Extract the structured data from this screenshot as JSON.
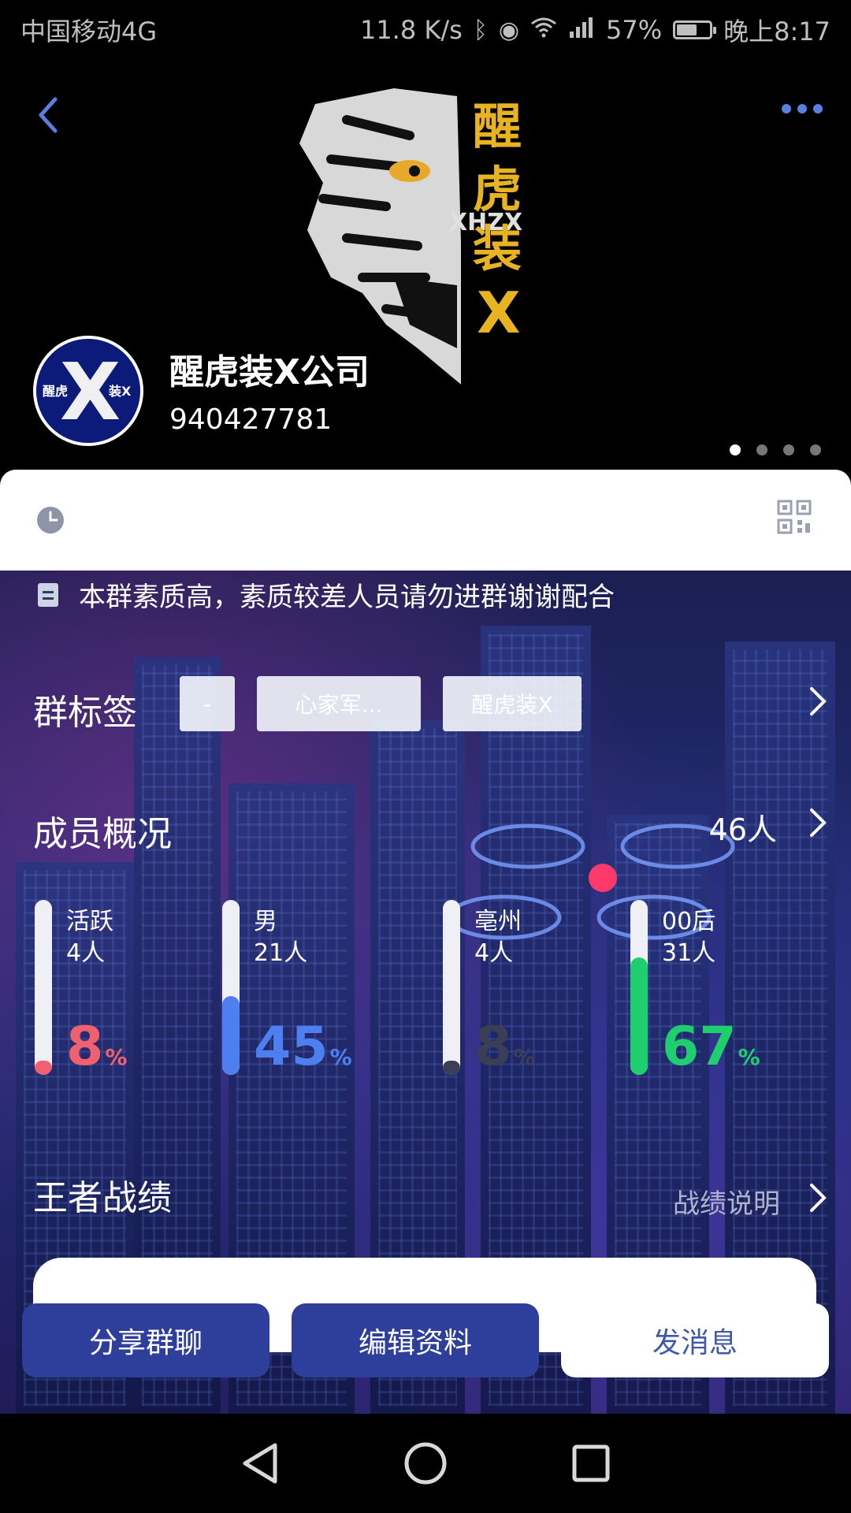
{
  "status_bar": {
    "carrier": "中国移动4G",
    "speed": "11.8 K/s",
    "battery": "57%",
    "battery_level": 0.57,
    "time": "晚上8:17"
  },
  "header": {
    "logo_text": [
      "醒",
      "虎",
      "装",
      "X"
    ],
    "logo_sub": "XHZX",
    "avatar_text_left": "醒虎",
    "avatar_text_right": "装X",
    "avatar_letter": "X",
    "group_name": "醒虎装X公司",
    "group_id": "940427781",
    "page_dots": 4,
    "active_dot": 0
  },
  "notice": "本群素质高，素质较差人员请勿进群谢谢配合",
  "tags_section": {
    "title": "群标签",
    "tags": [
      "-",
      "心家军...",
      "醒虎装X"
    ]
  },
  "members_section": {
    "title": "成员概况",
    "count": "46人",
    "stats": [
      {
        "label": "活跃",
        "count": "4人",
        "percent": "8",
        "fraction": 0.08,
        "color": "#f0606e"
      },
      {
        "label": "男",
        "count": "21人",
        "percent": "45",
        "fraction": 0.45,
        "color": "#4d7ff0"
      },
      {
        "label": "亳州",
        "count": "4人",
        "percent": "8",
        "fraction": 0.08,
        "color": "#3b3f55"
      },
      {
        "label": "00后",
        "count": "31人",
        "percent": "67",
        "fraction": 0.67,
        "color": "#1fcf6e"
      }
    ],
    "percent_unit": "%"
  },
  "record_section": {
    "title": "王者战绩",
    "link": "战绩说明"
  },
  "actions": {
    "share": "分享群聊",
    "edit": "编辑资料",
    "send": "发消息"
  }
}
